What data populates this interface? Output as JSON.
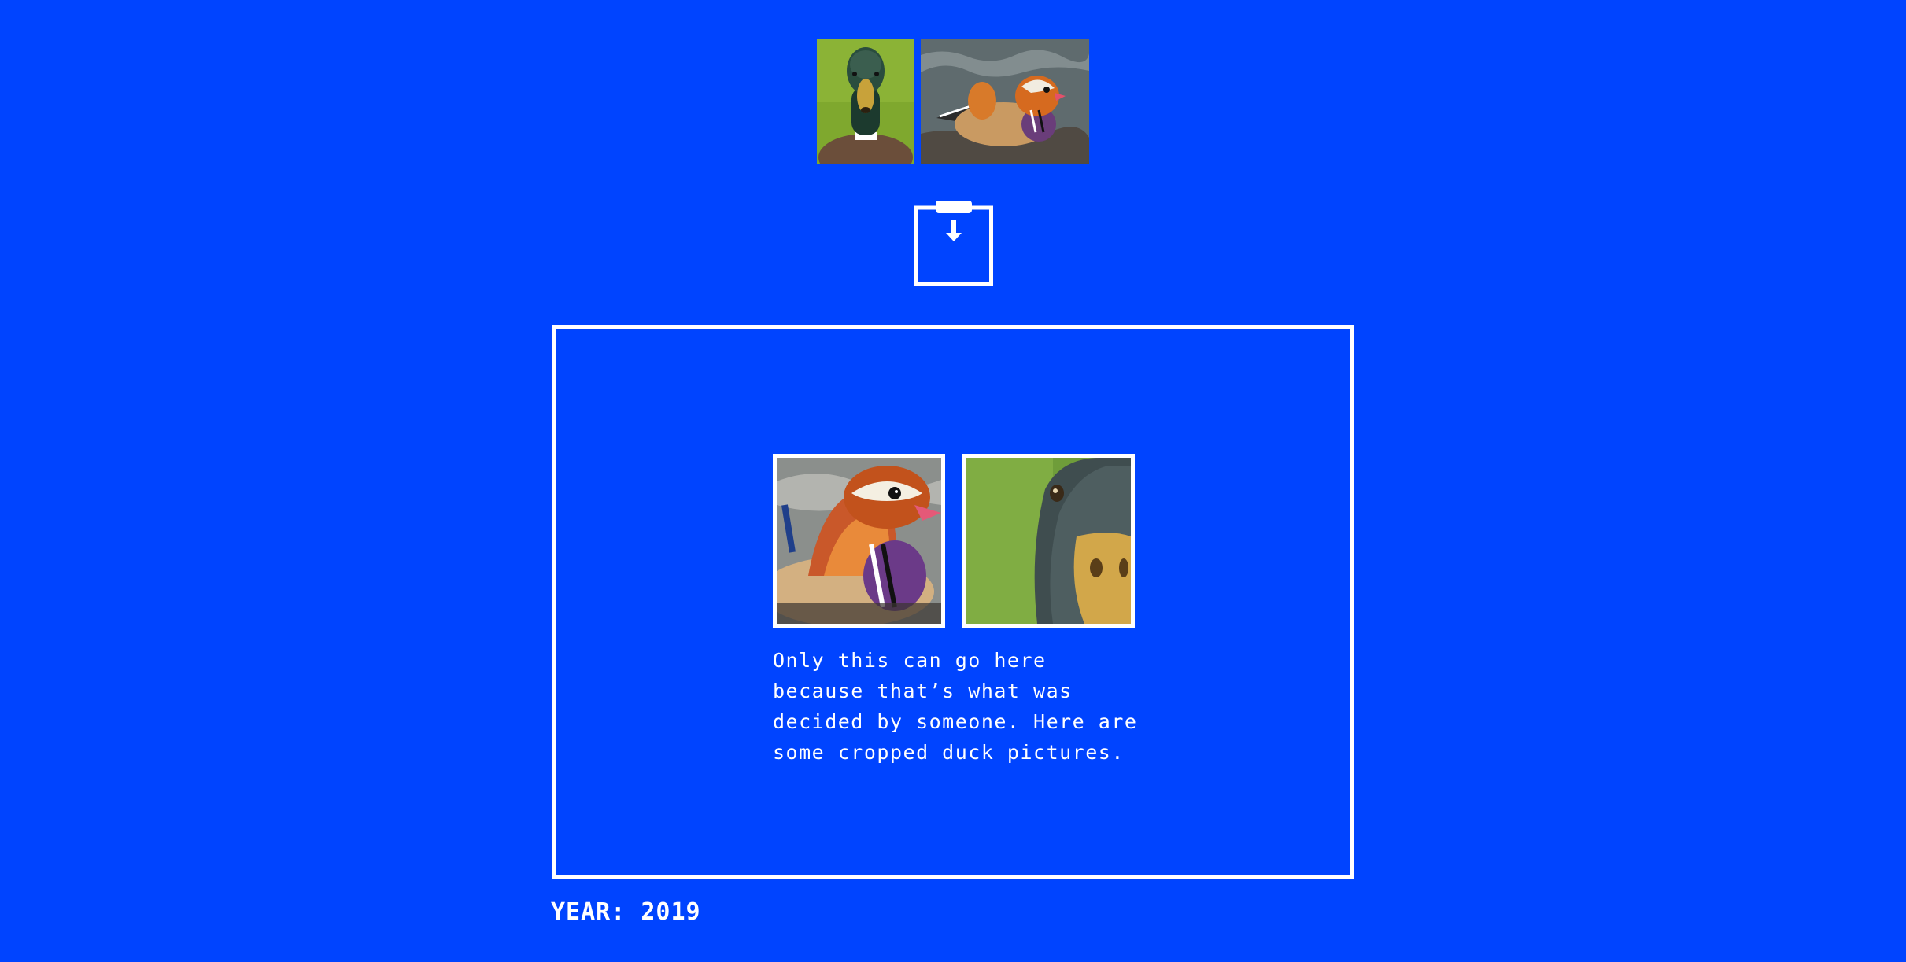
{
  "colors": {
    "background": "#0044ff",
    "foreground": "#ffffff"
  },
  "images": {
    "top_left": "mallard-duck-photo",
    "top_right": "mandarin-duck-photo",
    "crop_left": "mandarin-duck-closeup",
    "crop_right": "mallard-duck-closeup"
  },
  "icons": {
    "drop": "clipboard-download-icon"
  },
  "caption": "Only this can go here because that’s what was decided by someone. Here are some cropped duck pictures.",
  "year_label": "YEAR: 2019"
}
